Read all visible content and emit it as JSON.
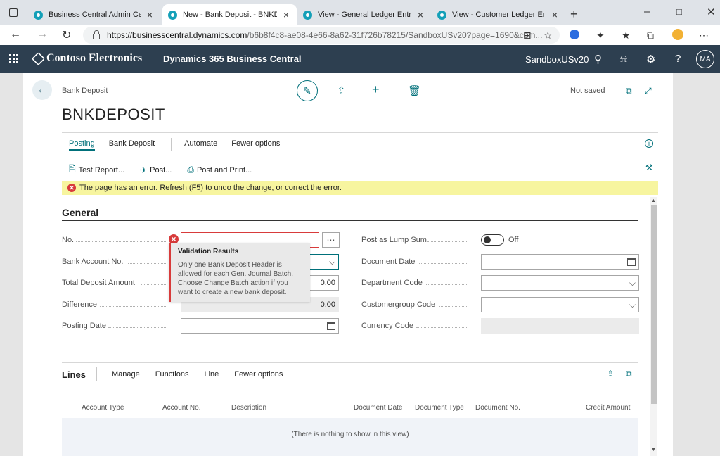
{
  "browser": {
    "tabs": [
      {
        "title": "Business Central Admin Center",
        "active": false
      },
      {
        "title": "New - Bank Deposit - BNKDEPOSIT",
        "active": true
      },
      {
        "title": "View - General Ledger Entries - ",
        "active": false
      },
      {
        "title": "View - Customer Ledger Entries",
        "active": false
      }
    ],
    "close_glyph": "×",
    "new_tab_glyph": "+",
    "url_host": "https://businesscentral.dynamics.com",
    "url_rest": "/b6b8f4c8-ae08-4e66-8a62-31f726b78215/SandboxUSv20?page=1690&com..."
  },
  "app": {
    "brand": "Contoso Electronics",
    "product": "Dynamics 365 Business Central",
    "environment": "SandboxUSv20",
    "user_initials": "MA"
  },
  "page": {
    "caption": "Bank Deposit",
    "title": "BNKDEPOSIT",
    "status": "Not saved"
  },
  "actions": {
    "tabs": [
      "Posting",
      "Bank Deposit",
      "Automate",
      "Fewer options"
    ],
    "selected_tab": "Posting",
    "sub_actions": [
      "Test Report...",
      "Post...",
      "Post and Print..."
    ]
  },
  "error_banner": "The page has an error. Refresh (F5) to undo the change, or correct the error.",
  "general": {
    "section_title": "General",
    "left_fields": [
      {
        "label": "No.",
        "value": ""
      },
      {
        "label": "Bank Account No.",
        "value": ""
      },
      {
        "label": "Total Deposit Amount",
        "value": "0.00"
      },
      {
        "label": "Difference",
        "value": "0.00"
      },
      {
        "label": "Posting Date",
        "value": ""
      }
    ],
    "right_fields": [
      {
        "label": "Post as Lump Sum",
        "value": "Off"
      },
      {
        "label": "Document Date",
        "value": ""
      },
      {
        "label": "Department Code",
        "value": ""
      },
      {
        "label": "Customergroup Code",
        "value": ""
      },
      {
        "label": "Currency Code",
        "value": ""
      }
    ]
  },
  "validation": {
    "title": "Validation Results",
    "message": "Only one Bank Deposit Header is allowed for each Gen. Journal Batch. Choose Change Batch action if you want to create a new bank deposit."
  },
  "lines": {
    "title": "Lines",
    "actions": [
      "Manage",
      "Functions",
      "Line",
      "Fewer options"
    ],
    "columns": [
      "Account Type",
      "Account No.",
      "Description",
      "Document Date",
      "Document Type",
      "Document No.",
      "Credit Amount"
    ],
    "empty_text": "(There is nothing to show in this view)"
  },
  "colors": {
    "accent": "#00707a",
    "header_bg": "#2d3f50",
    "error": "#d83b3b",
    "banner": "#f7f59f"
  }
}
